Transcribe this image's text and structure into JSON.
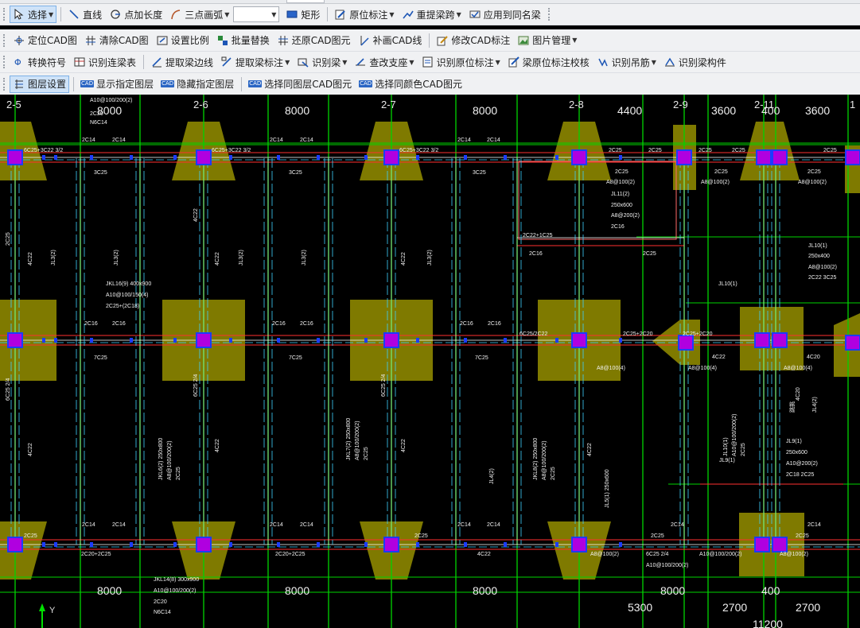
{
  "toolbar": {
    "row1": {
      "select": "选择",
      "line": "直线",
      "point_add_length": "点加长度",
      "three_point_arc": "三点画弧",
      "rectangle": "矩形",
      "original_annotation": "原位标注",
      "re_extract_span": "重提梁跨",
      "apply_same_name": "应用到同名梁"
    },
    "row2": {
      "locate_cad": "定位CAD图",
      "clear_cad": "清除CAD图",
      "set_scale": "设置比例",
      "batch_replace": "批量替换",
      "restore_cad": "还原CAD图元",
      "supplement_cad_line": "补画CAD线",
      "modify_cad_annotation": "修改CAD标注",
      "image_management": "图片管理"
    },
    "row3": {
      "convert_symbol": "转换符号",
      "recognize_continuous_beam": "识别连梁表",
      "extract_beam_edge": "提取梁边线",
      "extract_beam_annotation": "提取梁标注",
      "recognize_beam": "识别梁",
      "check_support": "查改支座",
      "recognize_original_annotation": "识别原位标注",
      "beam_annotation_check": "梁原位标注校核",
      "recognize_hanger": "识别吊筋",
      "recognize_beam_member": "识别梁构件"
    },
    "row4": {
      "layer_settings": "图层设置",
      "show_layer": "显示指定图层",
      "hide_layer": "隐藏指定图层",
      "select_same_layer": "选择同图层CAD图元",
      "select_same_color": "选择同颜色CAD图元",
      "cad_badge": "CAD"
    }
  },
  "drawing": {
    "axes_top": [
      "2-5",
      "2-6",
      "2-7",
      "2-8",
      "2-9",
      "2-11",
      "1"
    ],
    "dims_top": [
      "8000",
      "8000",
      "8000",
      "4400",
      "3600",
      "400",
      "3600"
    ],
    "dims_bottom": [
      "8000",
      "8000",
      "8000",
      "8000",
      "400"
    ],
    "dims_bottom2": [
      "5300",
      "2700",
      "2700"
    ],
    "dims_bottom3": "11200",
    "y_axis": "Y",
    "labels": {
      "a10_100_200_2": "A10@100/200(2)",
      "l2c20": "2C20",
      "n6c14": "N6C14",
      "c2c14": "2C14",
      "c3c25": "3C25",
      "c2c25": "2C25",
      "c7c25": "7C25",
      "c4c22": "4C22",
      "c2c16": "2C16",
      "c3c22_32": "6C25+3C22 3/2",
      "jkl16": "JKL16(9) 400x900",
      "jkl16_stirrup": "A10@100/150(4)",
      "jkl16_top": "2C25+(2C18)",
      "jkl14": "JKL14(8) 300x900",
      "jkl14_stirrup": "A10@100/200(2)",
      "jkl14_top": "2C20",
      "jl11": "JL11(2)",
      "jl11_size": "250x600",
      "jl11_stirrup": "A8@200(2)",
      "jl11_top": "2C16",
      "a8_100_2": "A8@100(2)",
      "jl10": "JL10(1)",
      "jl10_size": "250x400",
      "jl10_top": "2C22 3C25",
      "jl9": "JL9(1)",
      "jl9_size": "250x600",
      "jl9_stirrup": "A10@200(2)",
      "jl9_top": "2C18 2C25",
      "jl6": "JKL6(2) 250x800",
      "jl6_stirrup": "A8@100/200(2)",
      "jl7": "JKL7(2) 250x800",
      "jl8": "JKL8(2) 250x800",
      "c2c22_1c25": "2C22+1C25",
      "c6c25_2c22": "6C25/2C22",
      "c2c25_2c20": "2C25+2C20",
      "a8_100_4": "A8@100(4)",
      "c4c20": "4C20",
      "jl3": "JL3(2)",
      "jl4": "JL4(2)",
      "jl5": "JL5(1) 250x600",
      "c2c20_2c25": "2C20+2C25",
      "c6c25_24": "6C25 2/4",
      "c2c18": "2C18",
      "tiaoting": "跳挑"
    }
  },
  "colors": {
    "column": "#7f7a00",
    "grid": "#00d400",
    "beam_edge": "#ff3030",
    "center_line": "#ffffff",
    "magenta": "#b000e0",
    "blue_node": "#1b3cff"
  }
}
